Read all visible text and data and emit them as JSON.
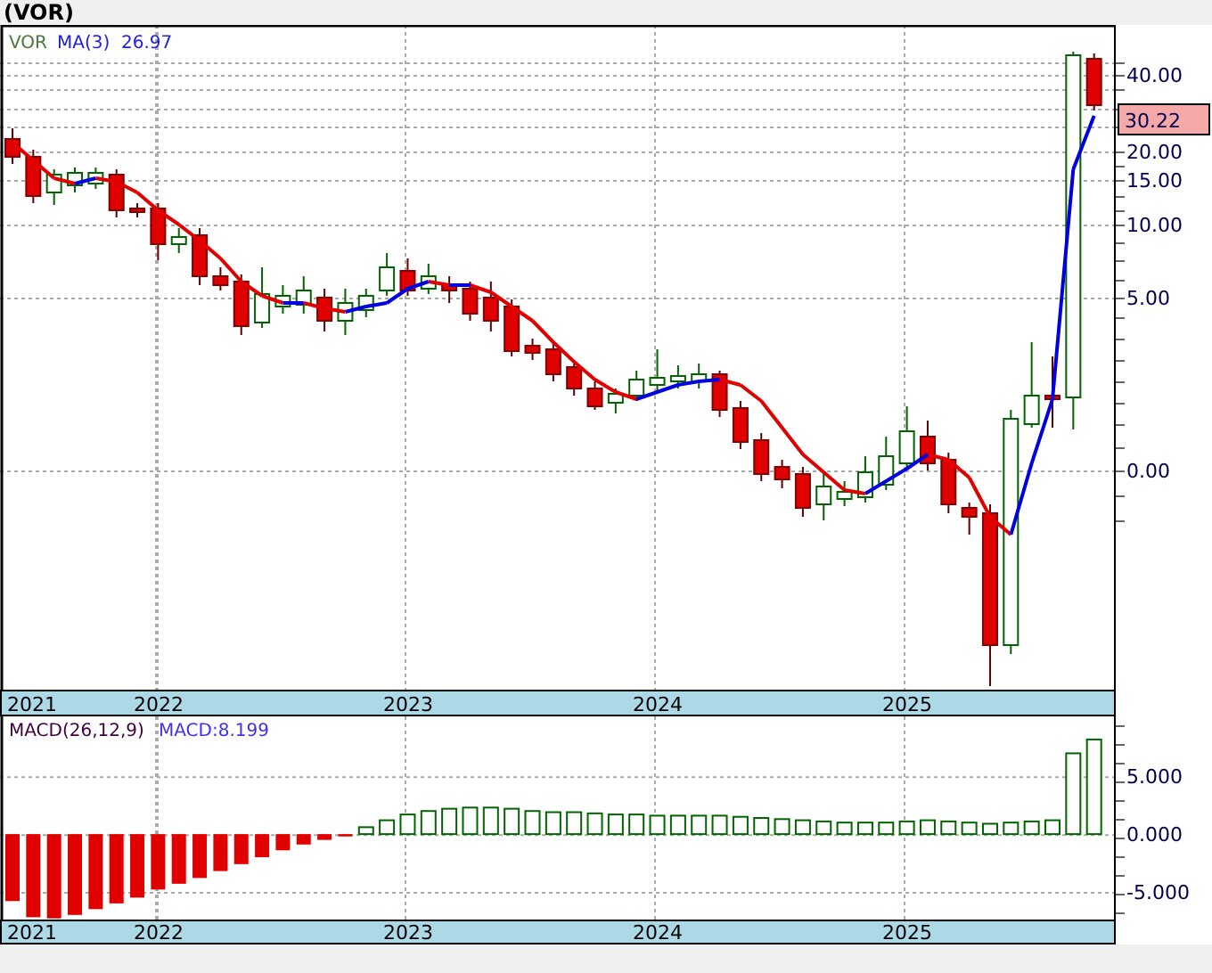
{
  "title": "(VOR)",
  "price_panel": {
    "legend": {
      "symbol": "VOR",
      "indicator": "MA(3)",
      "indicator_value": "26.97"
    },
    "y_axis_labels": [
      "40.00",
      "20.00",
      "15.00",
      "10.00",
      "5.00",
      "0.00"
    ],
    "last_price": "30.22"
  },
  "x_axis_labels": [
    "2021",
    "2022",
    "2023",
    "2024",
    "2025"
  ],
  "macd_panel": {
    "legend": {
      "name": "MACD(26,12,9)",
      "value": "MACD:8.199"
    },
    "chart_data": {
      "type": "bar",
      "grid": true,
      "ylim": [
        -7.4,
        10.2
      ],
      "values": [
        -5.8,
        -7.2,
        -7.3,
        -7,
        -6.5,
        -6,
        -5.5,
        -4.8,
        -4.3,
        -3.8,
        -3.2,
        -2.6,
        -2,
        -1.4,
        -0.9,
        -0.5,
        -0.2,
        0.6,
        1.2,
        1.7,
        2,
        2.2,
        2.3,
        2.3,
        2.2,
        2,
        1.9,
        1.9,
        1.8,
        1.7,
        1.7,
        1.6,
        1.6,
        1.6,
        1.6,
        1.5,
        1.4,
        1.3,
        1.2,
        1.1,
        1,
        1,
        1,
        1.1,
        1.2,
        1.1,
        1,
        0.9,
        1,
        1.1,
        1.2,
        7,
        8.2
      ],
      "yticks": [
        {
          "value": 5,
          "label": "5.000"
        },
        {
          "value": 0,
          "label": "0.000"
        },
        {
          "value": -5,
          "label": "-5.000"
        }
      ]
    }
  },
  "macd_x_axis_labels": [
    "2021",
    "2022",
    "2023",
    "2024",
    "2025"
  ]
}
